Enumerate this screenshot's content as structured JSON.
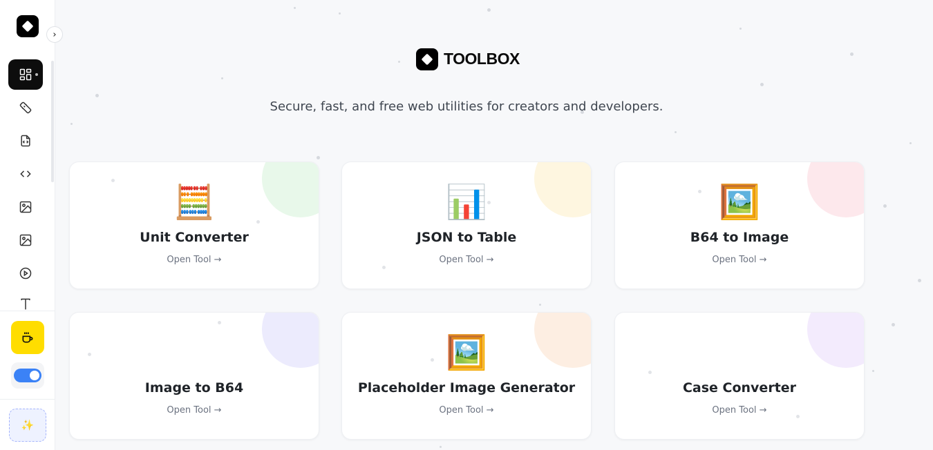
{
  "sidebar": {
    "nav_items": [
      {
        "name": "dashboard",
        "icon": "grid-icon",
        "active": true
      },
      {
        "name": "unit-converter",
        "icon": "ruler-icon"
      },
      {
        "name": "json-to-table",
        "icon": "file-code-icon"
      },
      {
        "name": "code",
        "icon": "code-icon"
      },
      {
        "name": "b64-to-image",
        "icon": "image-icon"
      },
      {
        "name": "image-to-b64",
        "icon": "image-icon"
      },
      {
        "name": "video",
        "icon": "play-circle-icon"
      },
      {
        "name": "text",
        "icon": "text-icon"
      }
    ],
    "coffee_icon": "coffee-cup-icon",
    "toggle_state": "on",
    "magic_icon": "✨",
    "colors": {
      "coffee": "#ffdd00",
      "toggle": "#3b82f6"
    }
  },
  "header": {
    "brand": "TOOLBOX",
    "tagline": "Secure, fast, and free web utilities for creators and developers."
  },
  "cards": [
    {
      "emoji": "🧮",
      "title": "Unit Converter",
      "link": "Open Tool →",
      "blob": "#e8f8ea"
    },
    {
      "emoji": "📊",
      "title": "JSON to Table",
      "link": "Open Tool →",
      "blob": "#fef6e0"
    },
    {
      "emoji": "🖼️",
      "title": "B64 to Image",
      "link": "Open Tool →",
      "blob": "#fde8ec"
    },
    {
      "emoji": "",
      "title": "Image to B64",
      "link": "Open Tool →",
      "blob": "#ecebfd"
    },
    {
      "emoji": "🖼️",
      "title": "Placeholder Image Generator",
      "link": "Open Tool →",
      "blob": "#fdeee2"
    },
    {
      "emoji": "",
      "title": "Case Converter",
      "link": "Open Tool →",
      "blob": "#f3ebfd"
    }
  ]
}
